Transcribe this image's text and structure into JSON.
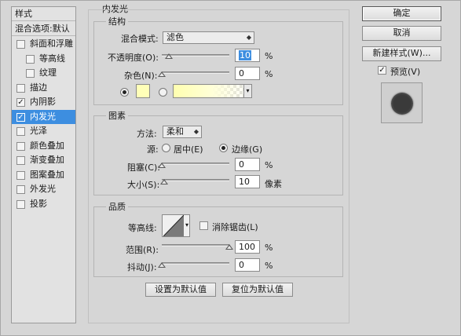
{
  "styles_list": {
    "header": "样式",
    "blend_options": "混合选项:默认",
    "items": [
      {
        "label": "斜面和浮雕",
        "checked": false,
        "indent": false
      },
      {
        "label": "等高线",
        "checked": false,
        "indent": true
      },
      {
        "label": "纹理",
        "checked": false,
        "indent": true
      },
      {
        "label": "描边",
        "checked": false,
        "indent": false
      },
      {
        "label": "内阴影",
        "checked": true,
        "indent": false
      },
      {
        "label": "内发光",
        "checked": true,
        "indent": false,
        "selected": true
      },
      {
        "label": "光泽",
        "checked": false,
        "indent": false
      },
      {
        "label": "颜色叠加",
        "checked": false,
        "indent": false
      },
      {
        "label": "渐变叠加",
        "checked": false,
        "indent": false
      },
      {
        "label": "图案叠加",
        "checked": false,
        "indent": false
      },
      {
        "label": "外发光",
        "checked": false,
        "indent": false
      },
      {
        "label": "投影",
        "checked": false,
        "indent": false
      }
    ]
  },
  "panel": {
    "title": "内发光",
    "structure": {
      "title": "结构",
      "blend_mode_label": "混合模式:",
      "blend_mode_value": "滤色",
      "opacity_label": "不透明度(O):",
      "opacity_value": "10",
      "opacity_unit": "%",
      "opacity_level": 0.1,
      "noise_label": "杂色(N):",
      "noise_value": "0",
      "noise_unit": "%",
      "noise_level": 0,
      "glow_color": "#ffffb8"
    },
    "elements": {
      "title": "图素",
      "method_label": "方法:",
      "method_value": "柔和",
      "source_label": "源:",
      "source_center": "居中(E)",
      "source_edge": "边缘(G)",
      "choke_label": "阻塞(C):",
      "choke_value": "0",
      "choke_unit": "%",
      "choke_level": 0,
      "size_label": "大小(S):",
      "size_value": "10",
      "size_unit": "像素",
      "size_level": 0.04
    },
    "quality": {
      "title": "品质",
      "contour_label": "等高线:",
      "antialias_label": "消除锯齿(L)",
      "range_label": "范围(R):",
      "range_value": "100",
      "range_unit": "%",
      "range_level": 1.0,
      "jitter_label": "抖动(J):",
      "jitter_value": "0",
      "jitter_unit": "%",
      "jitter_level": 0
    },
    "set_default": "设置为默认值",
    "reset_default": "复位为默认值"
  },
  "buttons": {
    "ok": "确定",
    "cancel": "取消",
    "new_style": "新建样式(W)...",
    "preview": "预览(V)"
  }
}
